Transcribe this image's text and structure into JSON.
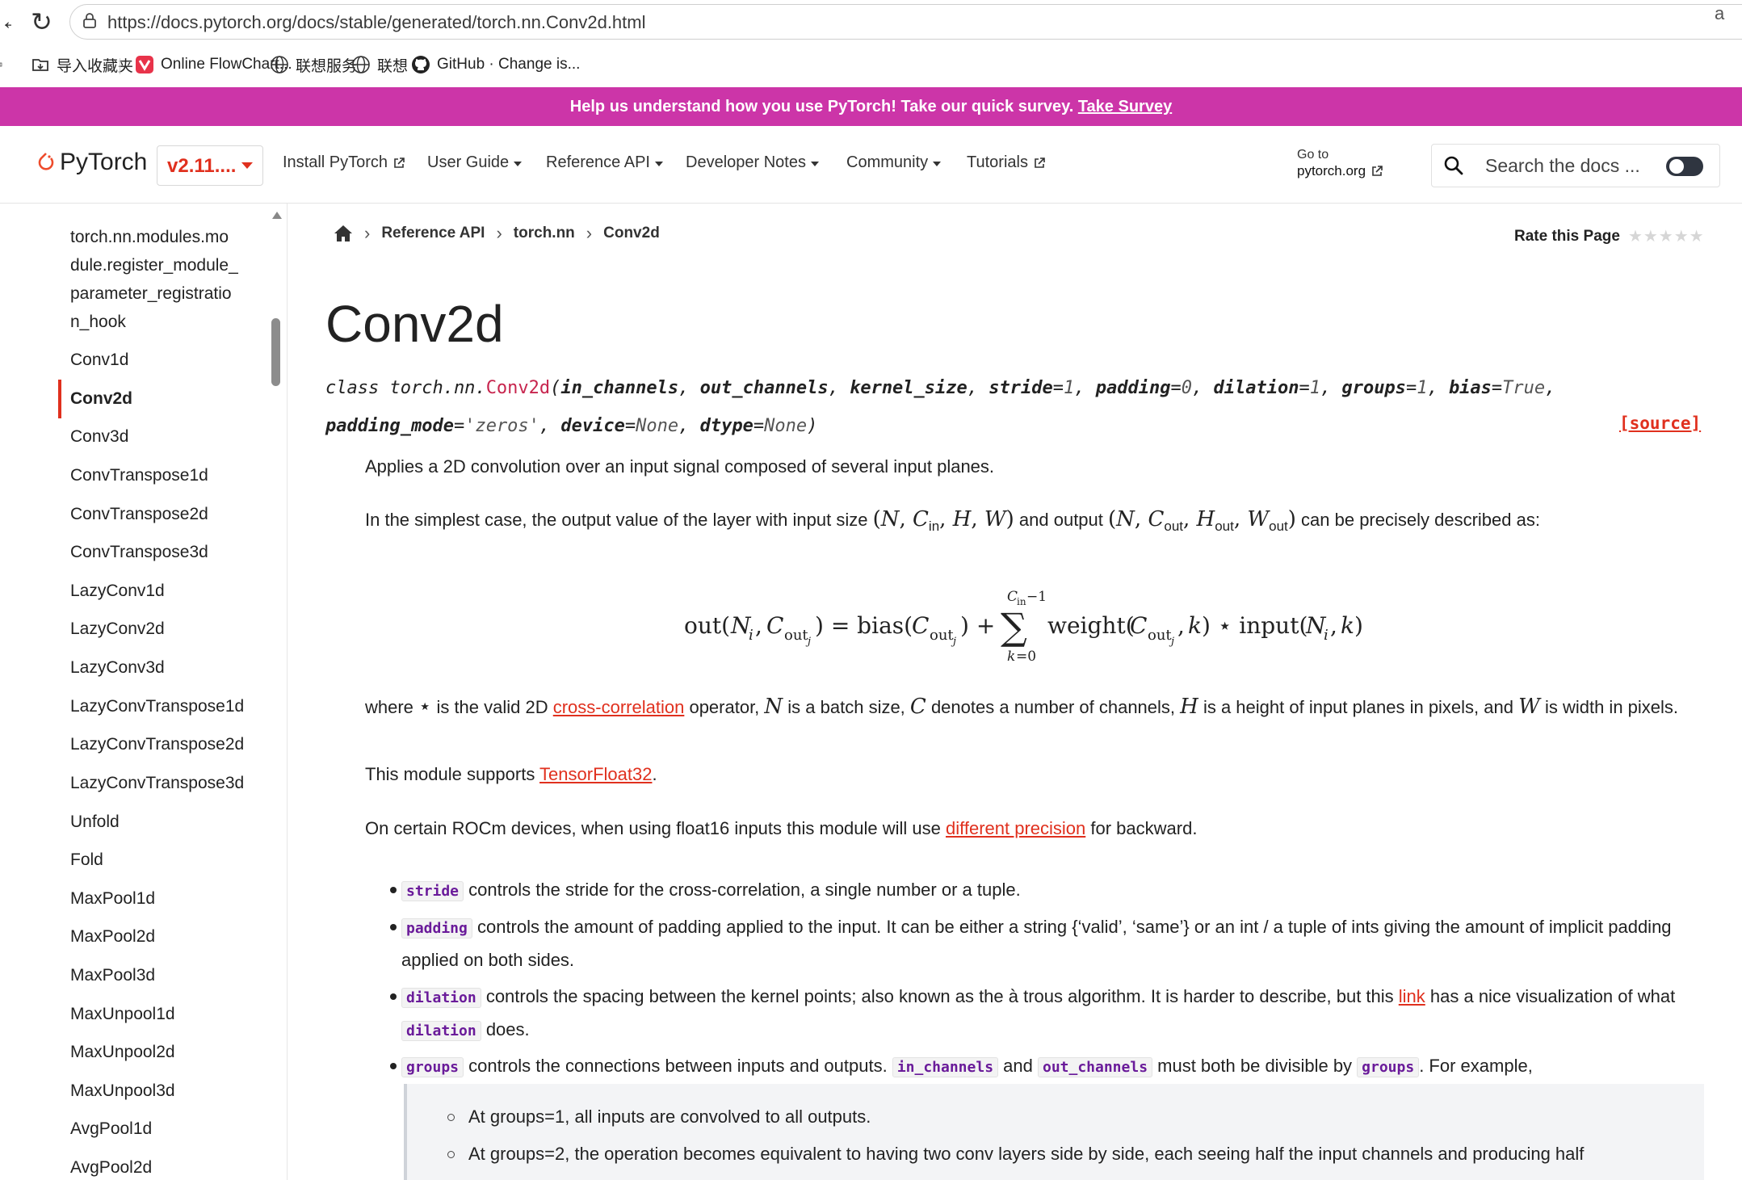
{
  "browser": {
    "url": "https://docs.pytorch.org/docs/stable/generated/torch.nn.Conv2d.html",
    "url_tail": "a",
    "bookmarks": [
      {
        "label": "导入收藏夹",
        "icon": "import-folder-icon"
      },
      {
        "label": "Online FlowChart...",
        "icon": "flowchart-app-icon"
      },
      {
        "label": "联想服务",
        "icon": "globe-icon"
      },
      {
        "label": "联想",
        "icon": "globe-icon"
      },
      {
        "label": "GitHub · Change is...",
        "icon": "github-icon"
      }
    ]
  },
  "survey": {
    "text": "Help us understand how you use PyTorch! Take our quick survey. ",
    "link": "Take Survey"
  },
  "header": {
    "logo": "PyTorch",
    "version": "v2.11....",
    "nav": [
      {
        "label": "Install PyTorch",
        "type": "external"
      },
      {
        "label": "User Guide",
        "type": "dropdown"
      },
      {
        "label": "Reference API",
        "type": "dropdown"
      },
      {
        "label": "Developer Notes",
        "type": "dropdown"
      },
      {
        "label": "Community",
        "type": "dropdown"
      },
      {
        "label": "Tutorials",
        "type": "external"
      }
    ],
    "goto_label": "Go to",
    "goto_link": "pytorch.org",
    "search_placeholder": "Search the docs ..."
  },
  "sidebar": {
    "items": [
      "torch.nn.modules.module.register_module_parameter_registration_hook",
      "Conv1d",
      "Conv2d",
      "Conv3d",
      "ConvTranspose1d",
      "ConvTranspose2d",
      "ConvTranspose3d",
      "LazyConv1d",
      "LazyConv2d",
      "LazyConv3d",
      "LazyConvTranspose1d",
      "LazyConvTranspose2d",
      "LazyConvTranspose3d",
      "Unfold",
      "Fold",
      "MaxPool1d",
      "MaxPool2d",
      "MaxPool3d",
      "MaxUnpool1d",
      "MaxUnpool2d",
      "MaxUnpool3d",
      "AvgPool1d",
      "AvgPool2d"
    ],
    "first_item_lines": [
      "torch.nn.modules.mo",
      "dule.register_module_",
      "parameter_registratio",
      "n_hook"
    ],
    "active": "Conv2d"
  },
  "breadcrumb": [
    "Reference API",
    "torch.nn",
    "Conv2d"
  ],
  "rate_label": "Rate this Page",
  "rate_stars": "★★★★★",
  "title": "Conv2d",
  "signature": {
    "prefix": "class torch.nn.",
    "name": "Conv2d",
    "line1_params": [
      {
        "name": "in_channels",
        "default": ""
      },
      {
        "name": "out_channels",
        "default": ""
      },
      {
        "name": "kernel_size",
        "default": ""
      },
      {
        "name": "stride",
        "default": "1"
      },
      {
        "name": "padding",
        "default": "0"
      },
      {
        "name": "dilation",
        "default": "1"
      },
      {
        "name": "groups",
        "default": "1"
      },
      {
        "name": "bias",
        "default": "True"
      }
    ],
    "line2_params": [
      {
        "name": "padding_mode",
        "default": "'zeros'"
      },
      {
        "name": "device",
        "default": "None"
      },
      {
        "name": "dtype",
        "default": "None"
      }
    ],
    "source": "[source]"
  },
  "content": {
    "intro": "Applies a 2D convolution over an input signal composed of several input planes.",
    "simplest_a": "In the simplest case, the output value of the layer with input size ",
    "simplest_b": " and output ",
    "simplest_c": " can be precisely described as:",
    "where_a": "where ",
    "where_b": " is the valid 2D ",
    "where_link": "cross-correlation",
    "where_c": " operator, ",
    "where_d": " is a batch size, ",
    "where_e": " denotes a number of channels, ",
    "where_f": " is a height of input planes in pixels, and ",
    "where_g": " is width in pixels.",
    "tf32_a": "This module supports ",
    "tf32_link": "TensorFloat32",
    "tf32_b": ".",
    "rocm_a": "On certain ROCm devices, when using float16 inputs this module will use ",
    "rocm_link": "different precision",
    "rocm_b": " for backward."
  },
  "bullets": {
    "stride_code": "stride",
    "stride_text": " controls the stride for the cross-correlation, a single number or a tuple.",
    "padding_code": "padding",
    "padding_text": " controls the amount of padding applied to the input. It can be either a string {‘valid’, ‘same’} or an int / a tuple of ints giving the amount of implicit padding applied on both sides.",
    "dilation_code": "dilation",
    "dilation_text_a": " controls the spacing between the kernel points; also known as the à trous algorithm. It is harder to describe, but this ",
    "dilation_link": "link",
    "dilation_text_b": " has a nice visualization of what ",
    "dilation_code2": "dilation",
    "dilation_text_c": " does.",
    "groups_code": "groups",
    "groups_text_a": " controls the connections between inputs and outputs. ",
    "groups_code2": "in_channels",
    "groups_text_b": " and ",
    "groups_code3": "out_channels",
    "groups_text_c": " must both be divisible by ",
    "groups_code4": "groups",
    "groups_text_d": ". For example,"
  },
  "note": [
    "At groups=1, all inputs are convolved to all outputs.",
    "At groups=2, the operation becomes equivalent to having two conv layers side by side, each seeing half the input channels and producing half"
  ],
  "colors": {
    "accent": "#e0301e",
    "banner": "#cc35a8",
    "code": "#6a1b9a"
  }
}
